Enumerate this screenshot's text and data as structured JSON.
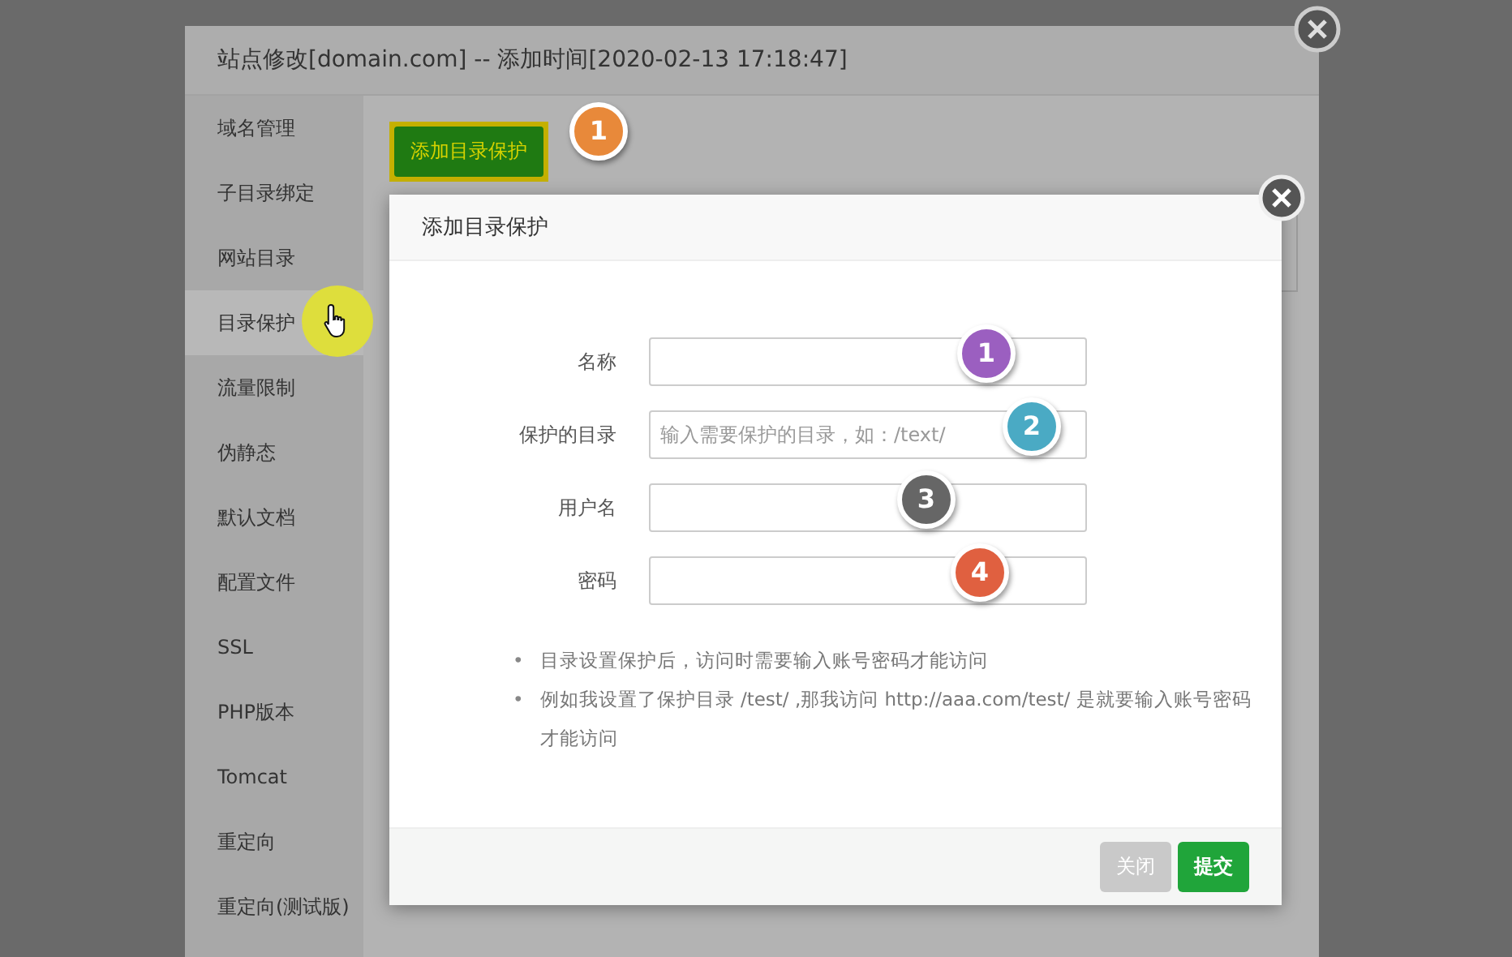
{
  "window": {
    "title": "站点修改[domain.com] -- 添加时间[2020-02-13 17:18:47]"
  },
  "sidebar": {
    "items": [
      {
        "label": "域名管理",
        "selected": false
      },
      {
        "label": "子目录绑定",
        "selected": false
      },
      {
        "label": "网站目录",
        "selected": false
      },
      {
        "label": "目录保护",
        "selected": true
      },
      {
        "label": "流量限制",
        "selected": false
      },
      {
        "label": "伪静态",
        "selected": false
      },
      {
        "label": "默认文档",
        "selected": false
      },
      {
        "label": "配置文件",
        "selected": false
      },
      {
        "label": "SSL",
        "selected": false
      },
      {
        "label": "PHP版本",
        "selected": false
      },
      {
        "label": "Tomcat",
        "selected": false
      },
      {
        "label": "重定向",
        "selected": false
      },
      {
        "label": "重定向(测试版)",
        "selected": false
      }
    ]
  },
  "add_button": {
    "label": "添加目录保护",
    "badge": {
      "number": "1",
      "color": "#e8893a"
    }
  },
  "modal": {
    "title": "添加目录保护",
    "fields": [
      {
        "label": "名称",
        "badge": {
          "number": "1",
          "color": "#9b5fc0"
        }
      },
      {
        "label": "保护的目录",
        "placeholder": "输入需要保护的目录，如：/text/",
        "badge": {
          "number": "2",
          "color": "#4aaac4"
        }
      },
      {
        "label": "用户名",
        "badge": {
          "number": "3",
          "color": "#666666"
        }
      },
      {
        "label": "密码",
        "badge": {
          "number": "4",
          "color": "#e06040"
        }
      }
    ],
    "notes": [
      {
        "bullet": "•",
        "text": "目录设置保护后，访问时需要输入账号密码才能访问"
      },
      {
        "bullet": "•",
        "text": "例如我设置了保护目录 /test/ ,那我访问 http://aaa.com/test/ 是就要输入账号密码才能访问"
      }
    ],
    "buttons": [
      {
        "label": "关闭",
        "kind": "secondary"
      },
      {
        "label": "提交",
        "kind": "primary"
      }
    ]
  }
}
